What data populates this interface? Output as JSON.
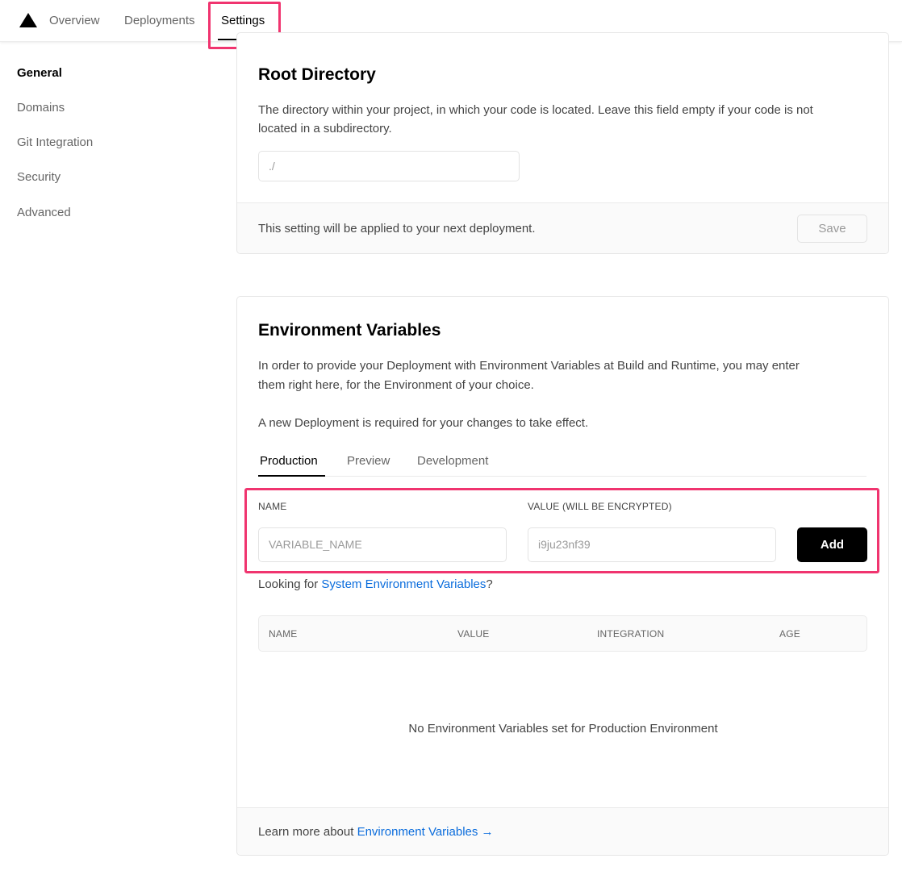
{
  "nav": {
    "items": [
      {
        "label": "Overview"
      },
      {
        "label": "Deployments"
      },
      {
        "label": "Settings"
      }
    ]
  },
  "sidebar": {
    "items": [
      {
        "label": "General"
      },
      {
        "label": "Domains"
      },
      {
        "label": "Git Integration"
      },
      {
        "label": "Security"
      },
      {
        "label": "Advanced"
      }
    ]
  },
  "root_directory": {
    "title": "Root Directory",
    "description_line1": "The directory within your project, in which your code is located. Leave this field empty if your code is not",
    "description_line2": "located in a subdirectory.",
    "input_value": "./",
    "footer_text": "This setting will be applied to your next deployment.",
    "save_label": "Save"
  },
  "env_vars": {
    "title": "Environment Variables",
    "description_line1": "In order to provide your Deployment with Environment Variables at Build and Runtime, you may enter",
    "description_line2": "them right here, for the Environment of your choice.",
    "note": "A new Deployment is required for your changes to take effect.",
    "tabs": [
      {
        "label": "Production"
      },
      {
        "label": "Preview"
      },
      {
        "label": "Development"
      }
    ],
    "name_label": "NAME",
    "value_label": "VALUE (WILL BE ENCRYPTED)",
    "name_placeholder": "VARIABLE_NAME",
    "value_placeholder": "i9ju23nf39",
    "add_label": "Add",
    "looking_prefix": "Looking for ",
    "looking_link": "System Environment Variables",
    "looking_suffix": "?",
    "table_headers": [
      "NAME",
      "VALUE",
      "INTEGRATION",
      "AGE"
    ],
    "empty_text": "No Environment Variables set for Production Environment",
    "footer_prefix": "Learn more about ",
    "footer_link": "Environment Variables →"
  },
  "colors": {
    "highlight": "#f0346f",
    "link": "#0a6cdc",
    "primary": "#000000"
  }
}
